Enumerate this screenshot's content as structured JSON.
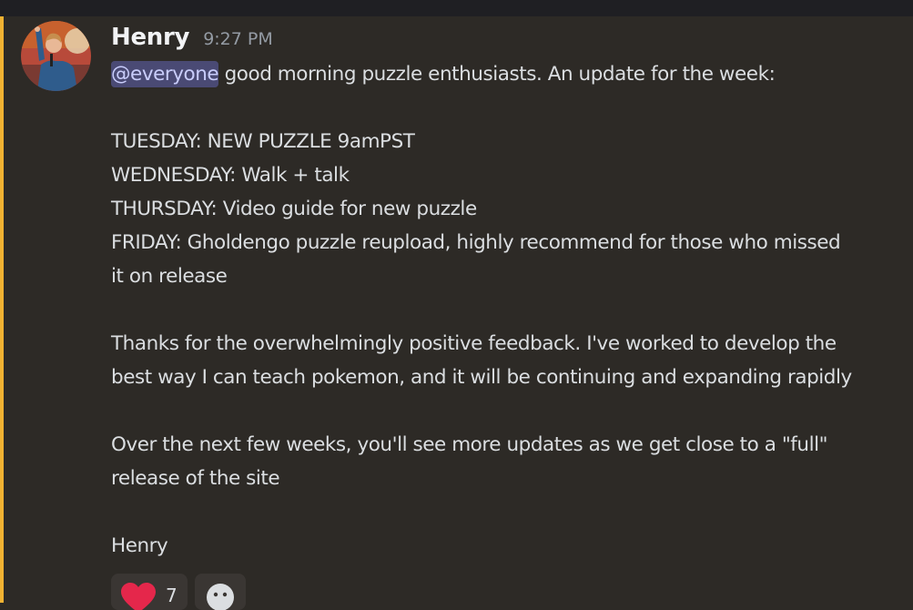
{
  "message": {
    "author": "Henry",
    "timestamp": "9:27 PM",
    "mention": "@everyone",
    "intro": " good morning puzzle enthusiasts. An update for the week:",
    "schedule": [
      "TUESDAY: NEW PUZZLE 9amPST",
      "WEDNESDAY: Walk + talk",
      "THURSDAY: Video guide for new puzzle",
      "FRIDAY: Gholdengo puzzle reupload, highly recommend for those who missed",
      "it on release"
    ],
    "thanks": [
      "Thanks for the overwhelmingly positive feedback. I've worked to develop the",
      "best way I can teach pokemon, and it will be continuing and expanding rapidly"
    ],
    "next": [
      "Over the next few weeks, you'll see more updates as we get close to a \"full\"",
      "release of the site"
    ],
    "signature": "Henry"
  },
  "reactions": [
    {
      "icon": "heart-icon",
      "count": "7"
    },
    {
      "icon": "add-reaction-icon",
      "count": ""
    }
  ],
  "colors": {
    "highlight_bar": "#f0b232",
    "mention_bg": "#4a4a74",
    "mention_text": "#c9cdfb",
    "heart": "#e5274b"
  }
}
